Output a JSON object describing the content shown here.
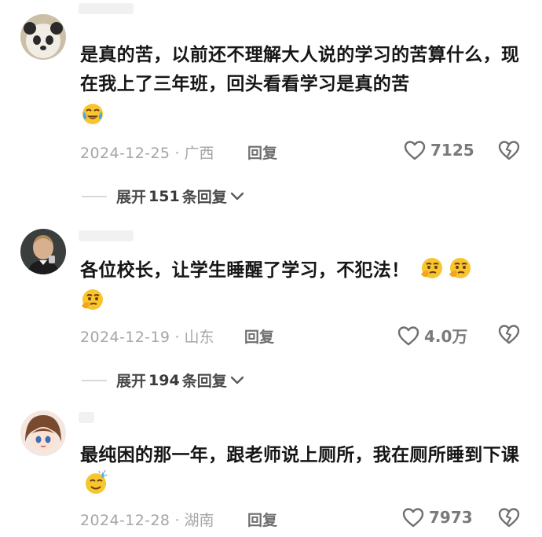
{
  "comments": [
    {
      "text": "是真的苦，以前还不理解大人说的学习的苦算什么，现在我上了三年班，回头看看学习是真的苦",
      "emoji_after": [
        "crying-laugh"
      ],
      "date": "2024-12-25",
      "location": "· 广西",
      "reply_label": "回复",
      "likes": "7125",
      "expand": {
        "prefix": "展开",
        "count": "151",
        "suffix": "条回复"
      }
    },
    {
      "text": "各位校长，让学生睡醒了学习，不犯法！",
      "emoji_after": [
        "thinking-face",
        "thinking-face",
        "thinking-face"
      ],
      "date": "2024-12-19",
      "location": "· 山东",
      "reply_label": "回复",
      "likes": "4.0万",
      "expand": {
        "prefix": "展开",
        "count": "194",
        "suffix": "条回复"
      }
    },
    {
      "text": "最纯困的那一年，跟老师说上厕所，我在厕所睡到下课",
      "emoji_after": [
        "sweat-smile"
      ],
      "date": "2024-12-28",
      "location": "· 湖南",
      "reply_label": "回复",
      "likes": "7973"
    }
  ],
  "colors": {
    "meta": "#a6a6a6",
    "text": "#161616",
    "accent_emoji": "#f5c024"
  },
  "icons": [
    "heart-outline-icon",
    "broken-heart-icon",
    "chevron-down-icon"
  ]
}
